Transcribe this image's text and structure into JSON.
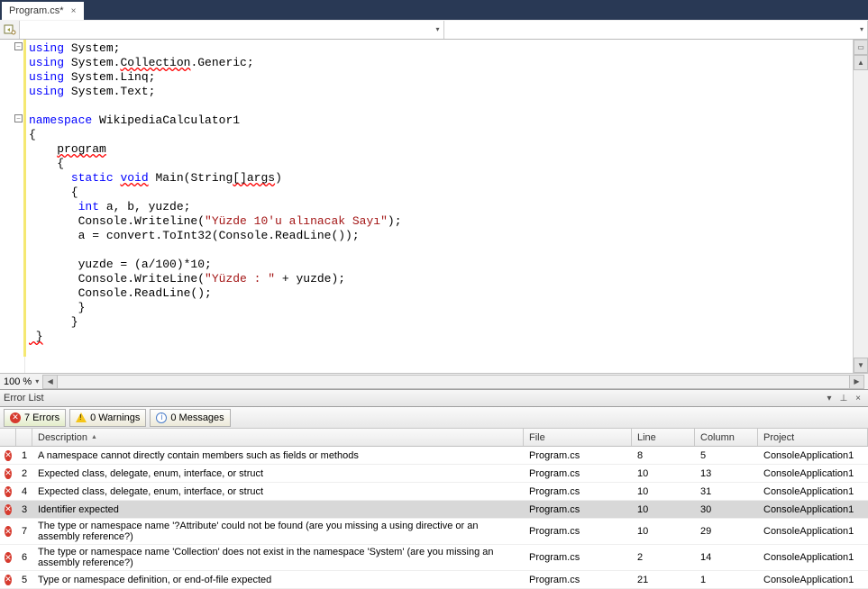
{
  "tab": {
    "title": "Program.cs*",
    "close": "×"
  },
  "zoom": "100 %",
  "errorlist": {
    "title": "Error List"
  },
  "filters": {
    "errors": "7 Errors",
    "warnings": "0 Warnings",
    "messages": "0 Messages"
  },
  "columns": {
    "desc": "Description",
    "file": "File",
    "line": "Line",
    "col": "Column",
    "proj": "Project"
  },
  "code": {
    "l1a": "using",
    "l1b": " System;",
    "l2a": "using",
    "l2b": " System.",
    "l2c": "Collection",
    "l2d": ".Generic;",
    "l3a": "using",
    "l3b": " System.Linq;",
    "l4a": "using",
    "l4b": " System.Text;",
    "l6a": "namespace",
    "l6b": " WikipediaCalculator1",
    "l7": "{",
    "l8a": "    ",
    "l8b": "program",
    "l9": "    {",
    "l10a": "      ",
    "l10b": "static",
    "l10c": " ",
    "l10d": "void",
    "l10e": " Main(String",
    "l10f": "[]args",
    "l10g": ")",
    "l11": "      {",
    "l12a": "       ",
    "l12b": "int",
    "l12c": " a, b, yuzde;",
    "l13a": "       Console.Writeline(",
    "l13b": "\"Yüzde 10'u alınacak Sayı\"",
    "l13c": ");",
    "l14": "       a = convert.ToInt32(Console.ReadLine());",
    "l16": "       yuzde = (a/100)*10;",
    "l17a": "       Console.WriteLine(",
    "l17b": "\"Yüzde : \"",
    "l17c": " + yuzde);",
    "l18": "       Console.ReadLine();",
    "l19": "       }",
    "l20": "      }",
    "l21": " }"
  },
  "errors": [
    {
      "idx": "1",
      "desc": "A namespace cannot directly contain members such as fields or methods",
      "file": "Program.cs",
      "line": "8",
      "col": "5",
      "proj": "ConsoleApplication1",
      "sel": false
    },
    {
      "idx": "2",
      "desc": "Expected class, delegate, enum, interface, or struct",
      "file": "Program.cs",
      "line": "10",
      "col": "13",
      "proj": "ConsoleApplication1",
      "sel": false
    },
    {
      "idx": "4",
      "desc": "Expected class, delegate, enum, interface, or struct",
      "file": "Program.cs",
      "line": "10",
      "col": "31",
      "proj": "ConsoleApplication1",
      "sel": false
    },
    {
      "idx": "3",
      "desc": "Identifier expected",
      "file": "Program.cs",
      "line": "10",
      "col": "30",
      "proj": "ConsoleApplication1",
      "sel": true
    },
    {
      "idx": "7",
      "desc": "The type or namespace name '?Attribute' could not be found (are you missing a using directive or an assembly reference?)",
      "file": "Program.cs",
      "line": "10",
      "col": "29",
      "proj": "ConsoleApplication1",
      "sel": false
    },
    {
      "idx": "6",
      "desc": "The type or namespace name 'Collection' does not exist in the namespace 'System' (are you missing an assembly reference?)",
      "file": "Program.cs",
      "line": "2",
      "col": "14",
      "proj": "ConsoleApplication1",
      "sel": false
    },
    {
      "idx": "5",
      "desc": "Type or namespace definition, or end-of-file expected",
      "file": "Program.cs",
      "line": "21",
      "col": "1",
      "proj": "ConsoleApplication1",
      "sel": false
    }
  ]
}
